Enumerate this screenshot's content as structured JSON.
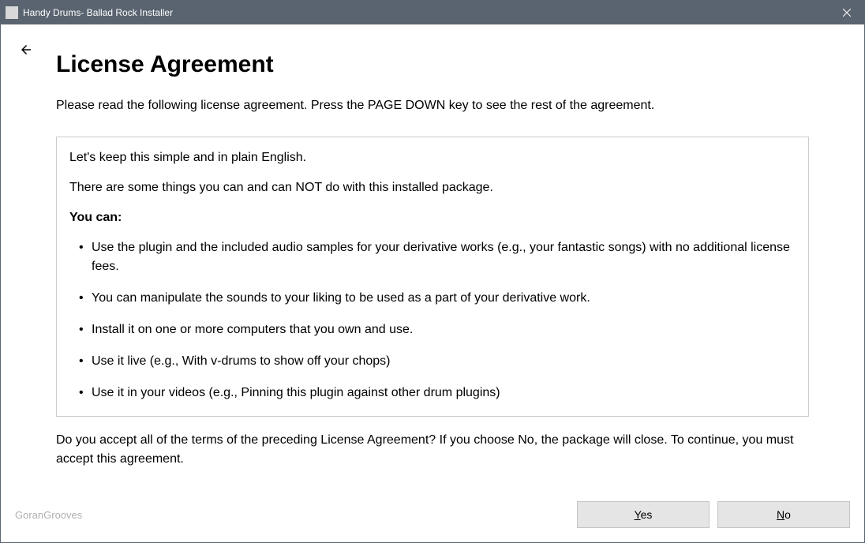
{
  "titlebar": {
    "title": "Handy Drums- Ballad Rock Installer"
  },
  "page": {
    "heading": "License Agreement",
    "instruction": "Please read the following license agreement. Press the PAGE DOWN key to see the rest of the agreement.",
    "acceptQuestion": "Do you accept all of the terms of the preceding License Agreement? If you choose No, the package will close. To continue, you must accept this agreement."
  },
  "license": {
    "intro1": "Let's keep this simple and in plain English.",
    "intro2": "There are some things you can and can NOT do with this installed package.",
    "canHeading": "You can:",
    "canItems": [
      "Use the plugin and the included audio samples for your derivative works (e.g., your fantastic songs) with no additional license fees.",
      "You can manipulate the sounds to your liking to be used as a part of your derivative work.",
      "Install it on one or more computers that you own and use.",
      "Use it live (e.g., With v-drums to show off your chops)",
      "Use it in your videos (e.g., Pinning this plugin against other drum plugins)"
    ]
  },
  "footer": {
    "brand": "GoranGrooves",
    "yesLabel": "es",
    "yesMnemonic": "Y",
    "noLabel": "o",
    "noMnemonic": "N"
  }
}
